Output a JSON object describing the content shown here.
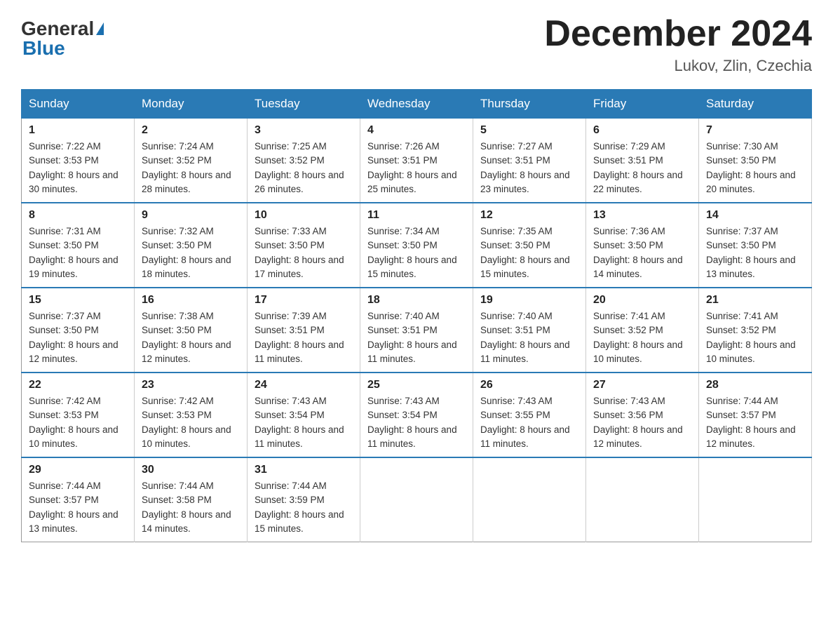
{
  "header": {
    "logo_general": "General",
    "logo_blue": "Blue",
    "title": "December 2024",
    "subtitle": "Lukov, Zlin, Czechia"
  },
  "days_of_week": [
    "Sunday",
    "Monday",
    "Tuesday",
    "Wednesday",
    "Thursday",
    "Friday",
    "Saturday"
  ],
  "weeks": [
    [
      {
        "day": "1",
        "sunrise": "7:22 AM",
        "sunset": "3:53 PM",
        "daylight": "8 hours and 30 minutes."
      },
      {
        "day": "2",
        "sunrise": "7:24 AM",
        "sunset": "3:52 PM",
        "daylight": "8 hours and 28 minutes."
      },
      {
        "day": "3",
        "sunrise": "7:25 AM",
        "sunset": "3:52 PM",
        "daylight": "8 hours and 26 minutes."
      },
      {
        "day": "4",
        "sunrise": "7:26 AM",
        "sunset": "3:51 PM",
        "daylight": "8 hours and 25 minutes."
      },
      {
        "day": "5",
        "sunrise": "7:27 AM",
        "sunset": "3:51 PM",
        "daylight": "8 hours and 23 minutes."
      },
      {
        "day": "6",
        "sunrise": "7:29 AM",
        "sunset": "3:51 PM",
        "daylight": "8 hours and 22 minutes."
      },
      {
        "day": "7",
        "sunrise": "7:30 AM",
        "sunset": "3:50 PM",
        "daylight": "8 hours and 20 minutes."
      }
    ],
    [
      {
        "day": "8",
        "sunrise": "7:31 AM",
        "sunset": "3:50 PM",
        "daylight": "8 hours and 19 minutes."
      },
      {
        "day": "9",
        "sunrise": "7:32 AM",
        "sunset": "3:50 PM",
        "daylight": "8 hours and 18 minutes."
      },
      {
        "day": "10",
        "sunrise": "7:33 AM",
        "sunset": "3:50 PM",
        "daylight": "8 hours and 17 minutes."
      },
      {
        "day": "11",
        "sunrise": "7:34 AM",
        "sunset": "3:50 PM",
        "daylight": "8 hours and 15 minutes."
      },
      {
        "day": "12",
        "sunrise": "7:35 AM",
        "sunset": "3:50 PM",
        "daylight": "8 hours and 15 minutes."
      },
      {
        "day": "13",
        "sunrise": "7:36 AM",
        "sunset": "3:50 PM",
        "daylight": "8 hours and 14 minutes."
      },
      {
        "day": "14",
        "sunrise": "7:37 AM",
        "sunset": "3:50 PM",
        "daylight": "8 hours and 13 minutes."
      }
    ],
    [
      {
        "day": "15",
        "sunrise": "7:37 AM",
        "sunset": "3:50 PM",
        "daylight": "8 hours and 12 minutes."
      },
      {
        "day": "16",
        "sunrise": "7:38 AM",
        "sunset": "3:50 PM",
        "daylight": "8 hours and 12 minutes."
      },
      {
        "day": "17",
        "sunrise": "7:39 AM",
        "sunset": "3:51 PM",
        "daylight": "8 hours and 11 minutes."
      },
      {
        "day": "18",
        "sunrise": "7:40 AM",
        "sunset": "3:51 PM",
        "daylight": "8 hours and 11 minutes."
      },
      {
        "day": "19",
        "sunrise": "7:40 AM",
        "sunset": "3:51 PM",
        "daylight": "8 hours and 11 minutes."
      },
      {
        "day": "20",
        "sunrise": "7:41 AM",
        "sunset": "3:52 PM",
        "daylight": "8 hours and 10 minutes."
      },
      {
        "day": "21",
        "sunrise": "7:41 AM",
        "sunset": "3:52 PM",
        "daylight": "8 hours and 10 minutes."
      }
    ],
    [
      {
        "day": "22",
        "sunrise": "7:42 AM",
        "sunset": "3:53 PM",
        "daylight": "8 hours and 10 minutes."
      },
      {
        "day": "23",
        "sunrise": "7:42 AM",
        "sunset": "3:53 PM",
        "daylight": "8 hours and 10 minutes."
      },
      {
        "day": "24",
        "sunrise": "7:43 AM",
        "sunset": "3:54 PM",
        "daylight": "8 hours and 11 minutes."
      },
      {
        "day": "25",
        "sunrise": "7:43 AM",
        "sunset": "3:54 PM",
        "daylight": "8 hours and 11 minutes."
      },
      {
        "day": "26",
        "sunrise": "7:43 AM",
        "sunset": "3:55 PM",
        "daylight": "8 hours and 11 minutes."
      },
      {
        "day": "27",
        "sunrise": "7:43 AM",
        "sunset": "3:56 PM",
        "daylight": "8 hours and 12 minutes."
      },
      {
        "day": "28",
        "sunrise": "7:44 AM",
        "sunset": "3:57 PM",
        "daylight": "8 hours and 12 minutes."
      }
    ],
    [
      {
        "day": "29",
        "sunrise": "7:44 AM",
        "sunset": "3:57 PM",
        "daylight": "8 hours and 13 minutes."
      },
      {
        "day": "30",
        "sunrise": "7:44 AM",
        "sunset": "3:58 PM",
        "daylight": "8 hours and 14 minutes."
      },
      {
        "day": "31",
        "sunrise": "7:44 AM",
        "sunset": "3:59 PM",
        "daylight": "8 hours and 15 minutes."
      },
      null,
      null,
      null,
      null
    ]
  ],
  "labels": {
    "sunrise_prefix": "Sunrise: ",
    "sunset_prefix": "Sunset: ",
    "daylight_prefix": "Daylight: "
  }
}
